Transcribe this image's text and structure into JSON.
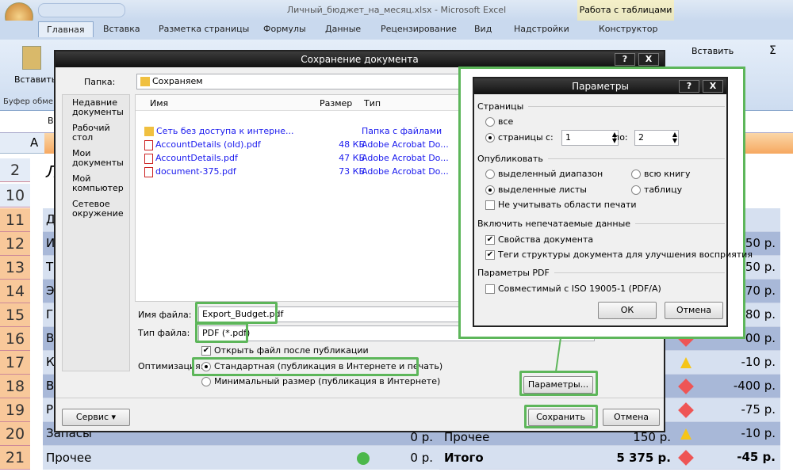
{
  "app": {
    "title": "Личный_бюджет_на_месяц.xlsx - Microsoft Excel",
    "context_tab_group": "Работа с таблицами",
    "tabs": [
      "Главная",
      "Вставка",
      "Разметка страницы",
      "Формулы",
      "Данные",
      "Рецензирование",
      "Вид",
      "Надстройки",
      "Конструктор"
    ],
    "ribbon": {
      "paste": "Вставить",
      "clipboard_group": "Буфер обме",
      "insert": "Вставить"
    }
  },
  "sheet": {
    "row_numbers": [
      "2",
      "10",
      "11",
      "12",
      "13",
      "14",
      "15",
      "16",
      "17",
      "18",
      "19",
      "20",
      "21"
    ],
    "col_a": "A",
    "cell_b": "В",
    "left_cells": [
      "Л",
      "",
      "Д",
      "И",
      "Т",
      "Э",
      "Г",
      "Во",
      "Ка",
      "Во",
      "Р",
      "Запасы",
      "Прочее"
    ],
    "right_values": [
      "",
      "",
      "",
      "50 р.",
      "50 р.",
      "70 р.",
      "80 р.",
      "00 р.",
      "-10 р.",
      "-400 р.",
      "-75 р.",
      "-10 р.",
      "-45 р."
    ],
    "row20": {
      "value": "0 р.",
      "right_label": "Прочее",
      "right_amount": "150 р."
    },
    "row21": {
      "value": "0 р.",
      "right_label": "Итого",
      "right_amount": "5 375 р."
    },
    "colors": {
      "row_header": "#f8c89a",
      "band_dark": "#a8b8d8",
      "band_light": "#d6e0f0"
    }
  },
  "save_dialog": {
    "title": "Сохранение документа",
    "folder_label": "Папка:",
    "folder": "Сохраняем",
    "places": [
      "Недавние документы",
      "Рабочий стол",
      "Мои документы",
      "Мой компьютер",
      "Сетевое окружение"
    ],
    "columns": [
      "Имя",
      "Размер",
      "Тип"
    ],
    "files": [
      {
        "name": "Сеть без доступа к интерне...",
        "size": "",
        "type": "Папка с файлами",
        "icon": "folder-icon"
      },
      {
        "name": "AccountDetails (old).pdf",
        "size": "48 КБ",
        "type": "Adobe Acrobat Do...",
        "icon": "pdf-icon"
      },
      {
        "name": "AccountDetails.pdf",
        "size": "47 КБ",
        "type": "Adobe Acrobat Do...",
        "icon": "pdf-icon"
      },
      {
        "name": "document-375.pdf",
        "size": "73 КБ",
        "type": "Adobe Acrobat Do...",
        "icon": "pdf-icon"
      }
    ],
    "filename_label": "Имя файла:",
    "filename": "Export_Budget.pdf",
    "filetype_label": "Тип файла:",
    "filetype": "PDF (*.pdf)",
    "open_after": "Открыть файл после публикации",
    "optimization_label": "Оптимизация:",
    "opt_standard": "Стандартная (публикация в Интернете и печать)",
    "opt_min": "Минимальный размер (публикация в Интернете)",
    "options_button": "Параметры...",
    "tools_button": "Сервис",
    "save_button": "Сохранить",
    "cancel_button": "Отмена"
  },
  "options_dialog": {
    "title": "Параметры",
    "pages_group": "Страницы",
    "all": "все",
    "pages": "страницы",
    "from_label": "с:",
    "from": "1",
    "to_label": "по:",
    "to": "2",
    "publish_group": "Опубликовать",
    "selection": "выделенный диапазон",
    "workbook": "всю книгу",
    "active_sheets": "выделенные листы",
    "table": "таблицу",
    "ignore_print_areas": "Не учитывать области печати",
    "nonprint_group": "Включить непечатаемые данные",
    "doc_props": "Свойства документа",
    "struct_tags": "Теги структуры документа для улучшения восприятия",
    "pdf_group": "Параметры PDF",
    "pdfa": "Совместимый с ISO 19005-1 (PDF/A)",
    "ok": "ОК",
    "cancel": "Отмена",
    "help": "?",
    "close": "X"
  },
  "highlight_color": "#5db65a"
}
